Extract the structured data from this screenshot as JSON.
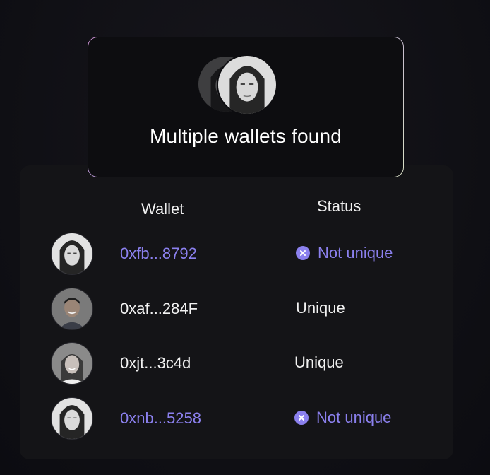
{
  "header": {
    "title": "Multiple wallets found"
  },
  "table": {
    "columns": {
      "wallet": "Wallet",
      "status": "Status"
    },
    "rows": [
      {
        "address": "0xfb...8792",
        "status": "Not unique",
        "flagged": true,
        "avatar": "person-long-hair"
      },
      {
        "address": "0xaf...284F",
        "status": "Unique",
        "flagged": false,
        "avatar": "person-smiling-man"
      },
      {
        "address": "0xjt...3c4d",
        "status": "Unique",
        "flagged": false,
        "avatar": "person-woman"
      },
      {
        "address": "0xnb...5258",
        "status": "Not unique",
        "flagged": true,
        "avatar": "person-long-hair"
      }
    ]
  },
  "colors": {
    "accent": "#8b80ee",
    "text": "#f2f2f2",
    "background": "#0f0f14",
    "panel": "#141417"
  },
  "icons": {
    "not_unique": "x-circle-icon"
  }
}
